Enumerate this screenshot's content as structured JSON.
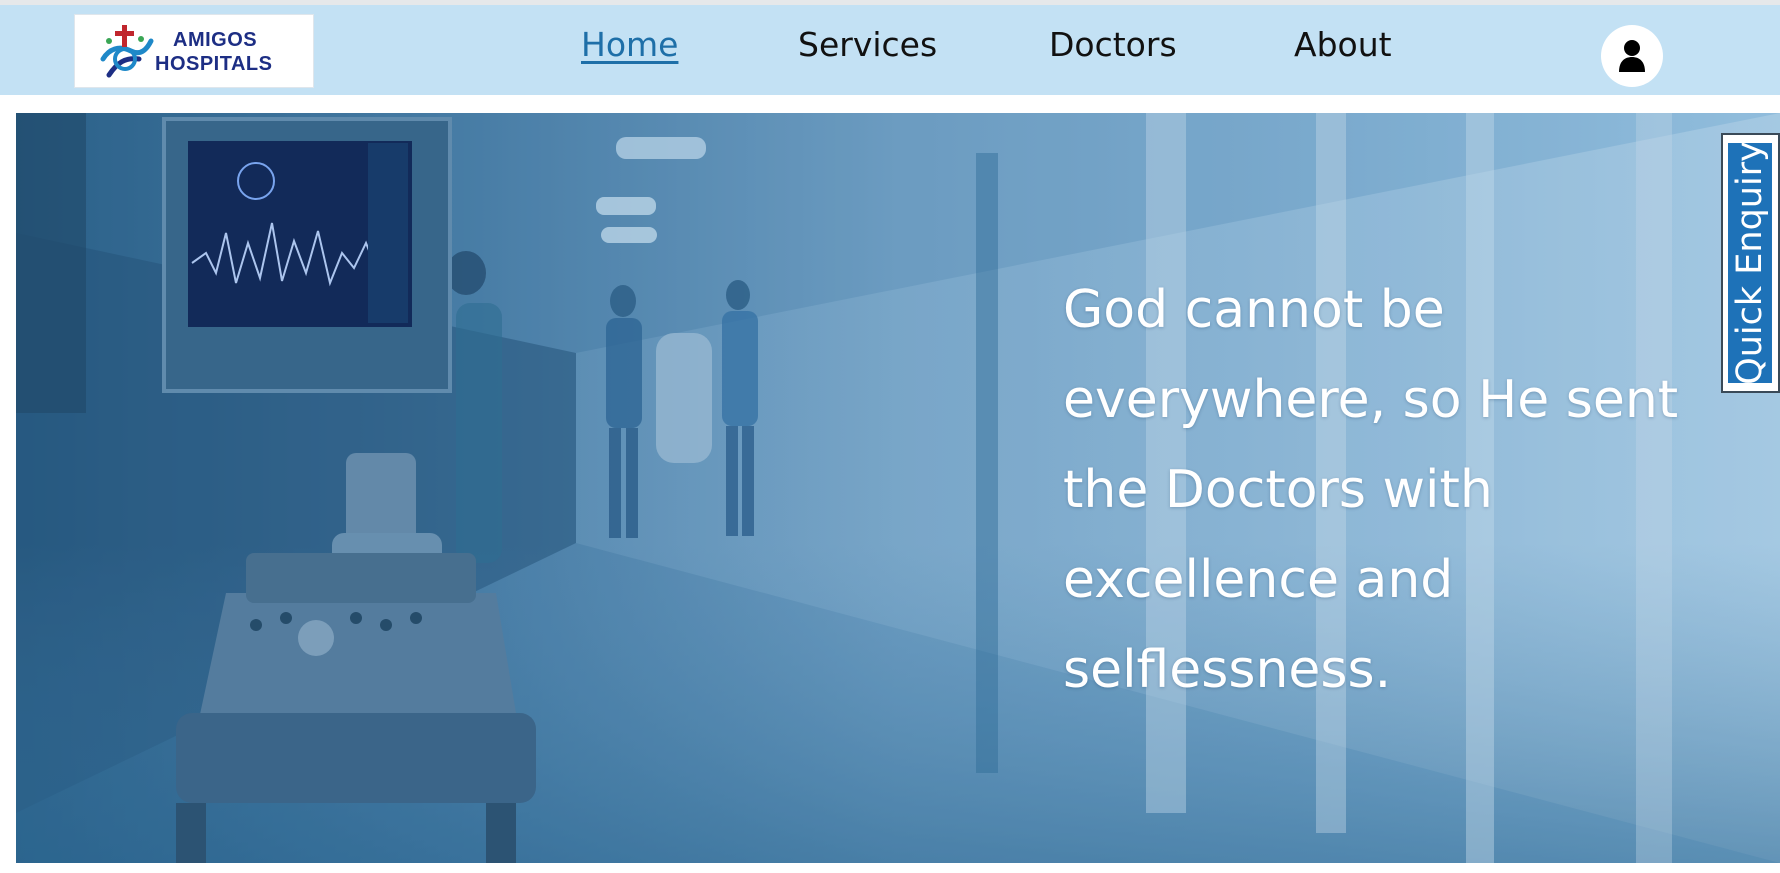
{
  "logo": {
    "line1": "AMIGOS",
    "line2": "HOSPITALS"
  },
  "nav": {
    "home": "Home",
    "services": "Services",
    "doctors": "Doctors",
    "about": "About"
  },
  "hero": {
    "quote": "God cannot be everywhere, so He sent the Doctors with excellence and selflessness."
  },
  "quick_enquiry": {
    "label": "Quick Enquiry"
  },
  "icons": {
    "profile": "user-icon"
  },
  "colors": {
    "navbar": "#c3e1f4",
    "active_link": "#1e6fa8",
    "enquiry": "#1e72b8"
  }
}
